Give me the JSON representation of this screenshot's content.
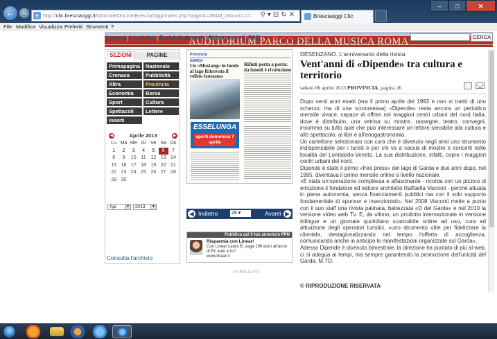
{
  "browser": {
    "back_label": "←",
    "forward_label": "→",
    "url_prefix": "http://",
    "url_host": "clic.bresciaoggi.it",
    "url_rest": "/GiornaleOnLine/BresciaOggi/index.php?pagina=26&id_articolo=1747429",
    "tab_title": "Bresciaoggi Clic",
    "window_controls": [
      "–",
      "□",
      "✕"
    ]
  },
  "menubar": [
    "File",
    "Modifica",
    "Visualizza",
    "Preferiti",
    "Strumenti",
    "?"
  ],
  "banner": {
    "text": "AUDITORIUM PARCO DELLA MUSICA  ROMA"
  },
  "nav": {
    "links": [
      "Logout",
      "I tuoi dati",
      "Scrivi al giornale",
      "Abbonamenti",
      "FAQ"
    ],
    "status": "Non abbonato",
    "search_button": "CERCA"
  },
  "left": {
    "tab_sezioni": "SEZIONI",
    "tab_pagine": "PAGINE",
    "sections": [
      "Primapagina",
      "Nazionale",
      "Cronaca",
      "Pubblicità",
      "Altra",
      "Provincia",
      "Economia",
      "Borsa",
      "Sport",
      "Cultura",
      "Spettacoli",
      "Lettere",
      "Inserti"
    ],
    "active_section": "Provincia",
    "calendar": {
      "title": "Aprile 2013",
      "days": [
        "Lu",
        "Ma",
        "Me",
        "Gi",
        "Ve",
        "Sa",
        "Do"
      ],
      "leading_blanks": 0,
      "count": 30,
      "active_until": 7,
      "selected": 6
    },
    "month_select": "Apr",
    "year_select": "2013",
    "archive_link": "Consulta l'archivio"
  },
  "paper": {
    "section": "Provincia",
    "location": "GARDA",
    "headline_left": "Un «Mustang» in fondo al lago Ritrovata il relitto fantasma",
    "headline_right": "Rifiuti porta a porta: da lunedì è rivoluzione",
    "ad_brand": "ESSELUNGA",
    "ad_text": "aperti domenica 7 aprile"
  },
  "pager": {
    "back_label": "Indietro",
    "page_value": "26",
    "next_label": "Avanti"
  },
  "promo": {
    "header": "Pubblica qui il tuo annuncio PPN",
    "title": "Risparmia con Linear!",
    "text": "Con Linear Laura B. paga 196 euro all'anno di Rc auto e tu?",
    "site": "www.linear.it"
  },
  "publicita": "PUBBLICITÀ",
  "article": {
    "kicker": "DESENZANO. L'anniversario della rivista",
    "title": "Vent'anni di «Dipende» tra cultura e territorio",
    "meta_date": "sabato 06 aprile 2013",
    "meta_section": "PROVINCIA",
    "meta_page": ", pagina 26",
    "body": [
      "Dopo venti anni esatti (era il primo aprile del 1993 e non si trattò di uno scherzo, ma di una scommessa) «Dipende» resta ancora un periodico mensile vivace, capace di offrire nei maggiori centri urbani del nord Italia, dove è distribuito, una vetrina su mostre, rassegne, teatro, convegni, insomma su tutto quel che può interessare un lettore sensibile alla cultura e allo spettacolo, ai libri e all'enogastronomia.",
      "Un cartellone selezionato con cura che è divenuto negli anni uno strumento indispensabile per i turisti e per chi va a caccia di mostre e concerti nelle località del Lombardo-Veneto. La sua distribuzione, infatti, copre i maggiori centri urbani del nord.",
      "Dipende è stato il primo «free press» del lago di Garda e due anni dopo, nel 1995, diventava il primo mensile online a livello nazionale.",
      "«È stata un'operazione complessa e affascinante - ricorda con un pizzico di emozione il fondatore ed editore architetto Raffaella Visconti - perché attuata in piena autonomia, senza finanziamenti pubblici ma con il solo supporto fondamentale di sponsor e inserzionisti». Nel 2008 Visconti mette a punto con il suo staff una rivista patinata, battezzata «D del Garda» e nel 2010 la versione video web Tv. E, da ultimo, un prodotto internazionale in versione trilingue e un giornale quotidiano scaricabile online ad uso, cura ed attuazione degli operatori turistici, «uno strumento utile per fidelizzare la clientela, destagionalizzando nel tempo l'offerta di accoglienza, comunicando anche in anticipo le manifestazioni organizzate sul Garda».",
      "Adesso Dipende è divenuto bimestrale, la direzione ha puntato di più al web, ci si adegua ai tempi, ma sempre garantendo la promozione dell'unicità del Garda. M.TO."
    ],
    "copyright": "© RIPRODUZIONE RISERVATA"
  },
  "colors": {
    "banner": "#b1312a",
    "nav_link": "#24527e",
    "active_section": "#f5d21f",
    "selected_day": "#a52626"
  }
}
